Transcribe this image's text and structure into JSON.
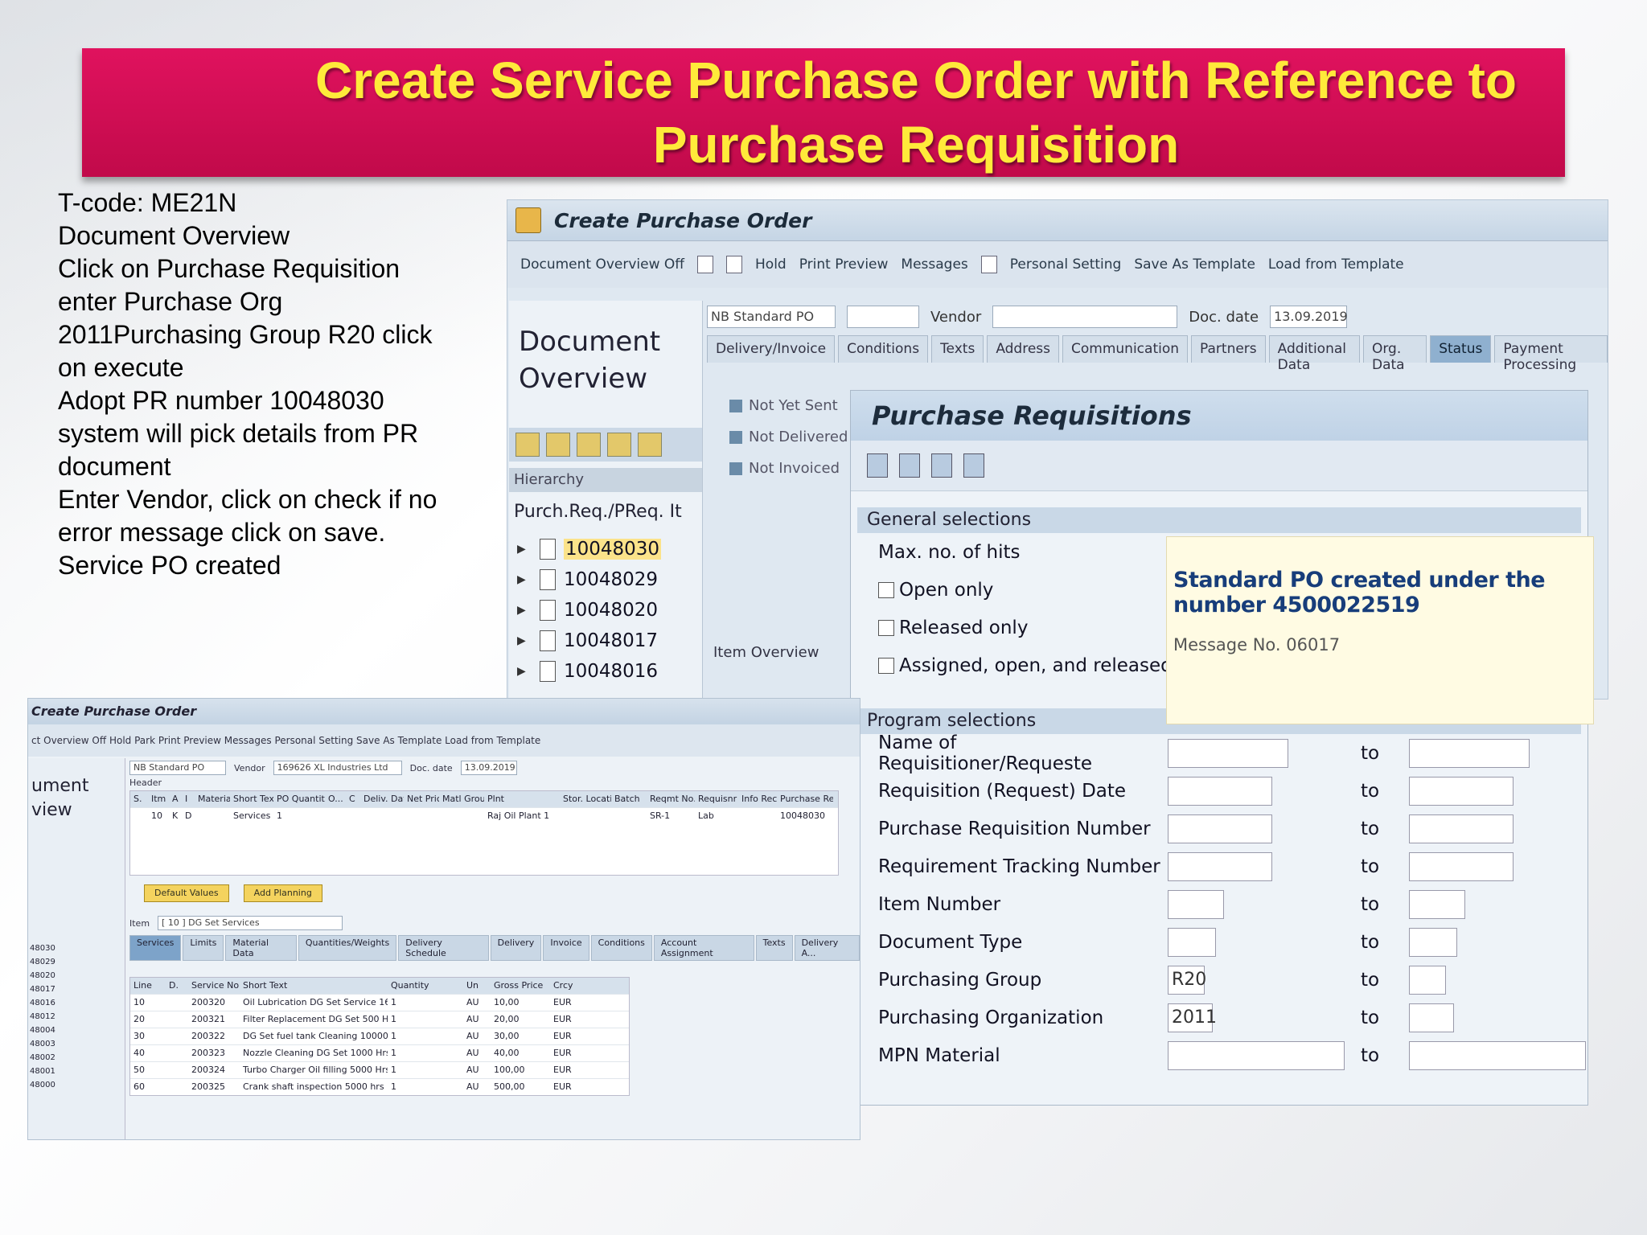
{
  "banner": {
    "title": "Create Service Purchase Order with Reference to Purchase Requisition"
  },
  "steps": [
    "T-code: ME21N",
    "Document Overview",
    "Click on Purchase Requisition",
    "enter Purchase Org",
    "2011Purchasing Group R20 click",
    "on execute",
    "Adopt PR number 10048030",
    "system will pick details from PR",
    "document",
    "Enter Vendor, click on check if no",
    "error message click on save.",
    "Service PO created"
  ],
  "sap": {
    "window_title": "Create Purchase Order",
    "toolbar": [
      "Document Overview Off",
      "Hold",
      "Print Preview",
      "Messages",
      "Personal Setting",
      "Save As Template",
      "Load from Template"
    ],
    "doc_overview": {
      "line1": "Document",
      "line2": "Overview",
      "hierarchy": "Hierarchy",
      "column": "Purch.Req./PReq. It"
    },
    "pr_list": [
      "10048030",
      "10048029",
      "10048020",
      "10048017",
      "10048016"
    ],
    "header": {
      "doc_type": "NB Standard PO",
      "vendor_label": "Vendor",
      "doc_date_label": "Doc. date",
      "doc_date": "13.09.2019"
    },
    "tabs": [
      "Delivery/Invoice",
      "Conditions",
      "Texts",
      "Address",
      "Communication",
      "Partners",
      "Additional Data",
      "Org. Data",
      "Status",
      "Payment Processing"
    ],
    "active_tab": "Status",
    "status_items": [
      "Not Yet Sent",
      "Not Delivered",
      "Not Invoiced"
    ],
    "item_overview": "Item Overview"
  },
  "pr_dialog": {
    "title": "Purchase Requisitions",
    "general_section": "General selections",
    "max_hits": "Max. no. of hits",
    "checkboxes": [
      "Open only",
      "Released only",
      "Assigned, open, and released"
    ],
    "program_section": "Program selections",
    "to_label": "to",
    "fields": [
      {
        "label": "Name of Requisitioner/Requeste",
        "value": ""
      },
      {
        "label": "Requisition (Request) Date",
        "value": ""
      },
      {
        "label": "Purchase Requisition Number",
        "value": ""
      },
      {
        "label": "Requirement Tracking Number",
        "value": ""
      },
      {
        "label": "Item Number",
        "value": ""
      },
      {
        "label": "Document Type",
        "value": ""
      },
      {
        "label": "Purchasing Group",
        "value": "R20"
      },
      {
        "label": "Purchasing Organization",
        "value": "2011"
      },
      {
        "label": "MPN Material",
        "value": ""
      }
    ]
  },
  "message": {
    "text": "Standard PO created under the number 4500022519",
    "number": "Message No. 06017"
  },
  "shot2": {
    "title": "Create Purchase Order",
    "toolbar": "ct Overview Off   Hold   Park   Print Preview   Messages   Personal Setting   Save As Template   Load from Template",
    "side_line1": "ument",
    "side_line2": "view",
    "side_ids": [
      "48030",
      "48029",
      "48020",
      "48017",
      "48016",
      "48012",
      "48004",
      "48003",
      "48002",
      "48001",
      "48000"
    ],
    "doc_type": "NB Standard PO",
    "vendor_label": "Vendor",
    "vendor": "169626 XL Industries Ltd",
    "doc_date_label": "Doc. date",
    "doc_date": "13.09.2019",
    "header_label": "Header",
    "item_cols": [
      "S.",
      "Itm",
      "A",
      "I",
      "Material",
      "Short Text",
      "PO Quantity",
      "O...",
      "C",
      "Deliv. Date",
      "Net Price",
      "Matl Group",
      "Plnt",
      "Stor. Location",
      "Batch",
      "Reqmt No.",
      "Requisnr",
      "Info Rec.",
      "Purchase Req."
    ],
    "item_row": [
      "",
      "10",
      "K",
      "D",
      "",
      "Services",
      "1",
      "",
      "",
      "",
      "",
      "",
      "Raj Oil Plant 1",
      "",
      "",
      "SR-1",
      "Lab",
      "",
      "10048030"
    ],
    "btn_default": "Default Values",
    "btn_planning": "Add Planning",
    "item_label": "Item",
    "item_sel": "[ 10 ] DG Set Services",
    "tabs": [
      "Services",
      "Limits",
      "Material Data",
      "Quantities/Weights",
      "Delivery Schedule",
      "Delivery",
      "Invoice",
      "Conditions",
      "Account Assignment",
      "Texts",
      "Delivery A..."
    ],
    "svc_cols": [
      "Line",
      "D.",
      "Service No.",
      "Short Text",
      "Quantity",
      "Un",
      "Gross Price",
      "Crcy"
    ],
    "svc_rows": [
      [
        "10",
        "",
        "200320",
        "Oil Lubrication DG Set Service 168 H...",
        "1",
        "AU",
        "10,00",
        "EUR"
      ],
      [
        "20",
        "",
        "200321",
        "Filter Replacement DG Set 500 Hrs",
        "1",
        "AU",
        "20,00",
        "EUR"
      ],
      [
        "30",
        "",
        "200322",
        "DG Set fuel tank Cleaning 10000 HRS",
        "1",
        "AU",
        "30,00",
        "EUR"
      ],
      [
        "40",
        "",
        "200323",
        "Nozzle Cleaning DG Set 1000 Hrs",
        "1",
        "AU",
        "40,00",
        "EUR"
      ],
      [
        "50",
        "",
        "200324",
        "Turbo Charger Oil filling 5000 Hrs",
        "1",
        "AU",
        "100,00",
        "EUR"
      ],
      [
        "60",
        "",
        "200325",
        "Crank shaft inspection 5000 hrs",
        "1",
        "AU",
        "500,00",
        "EUR"
      ]
    ]
  }
}
